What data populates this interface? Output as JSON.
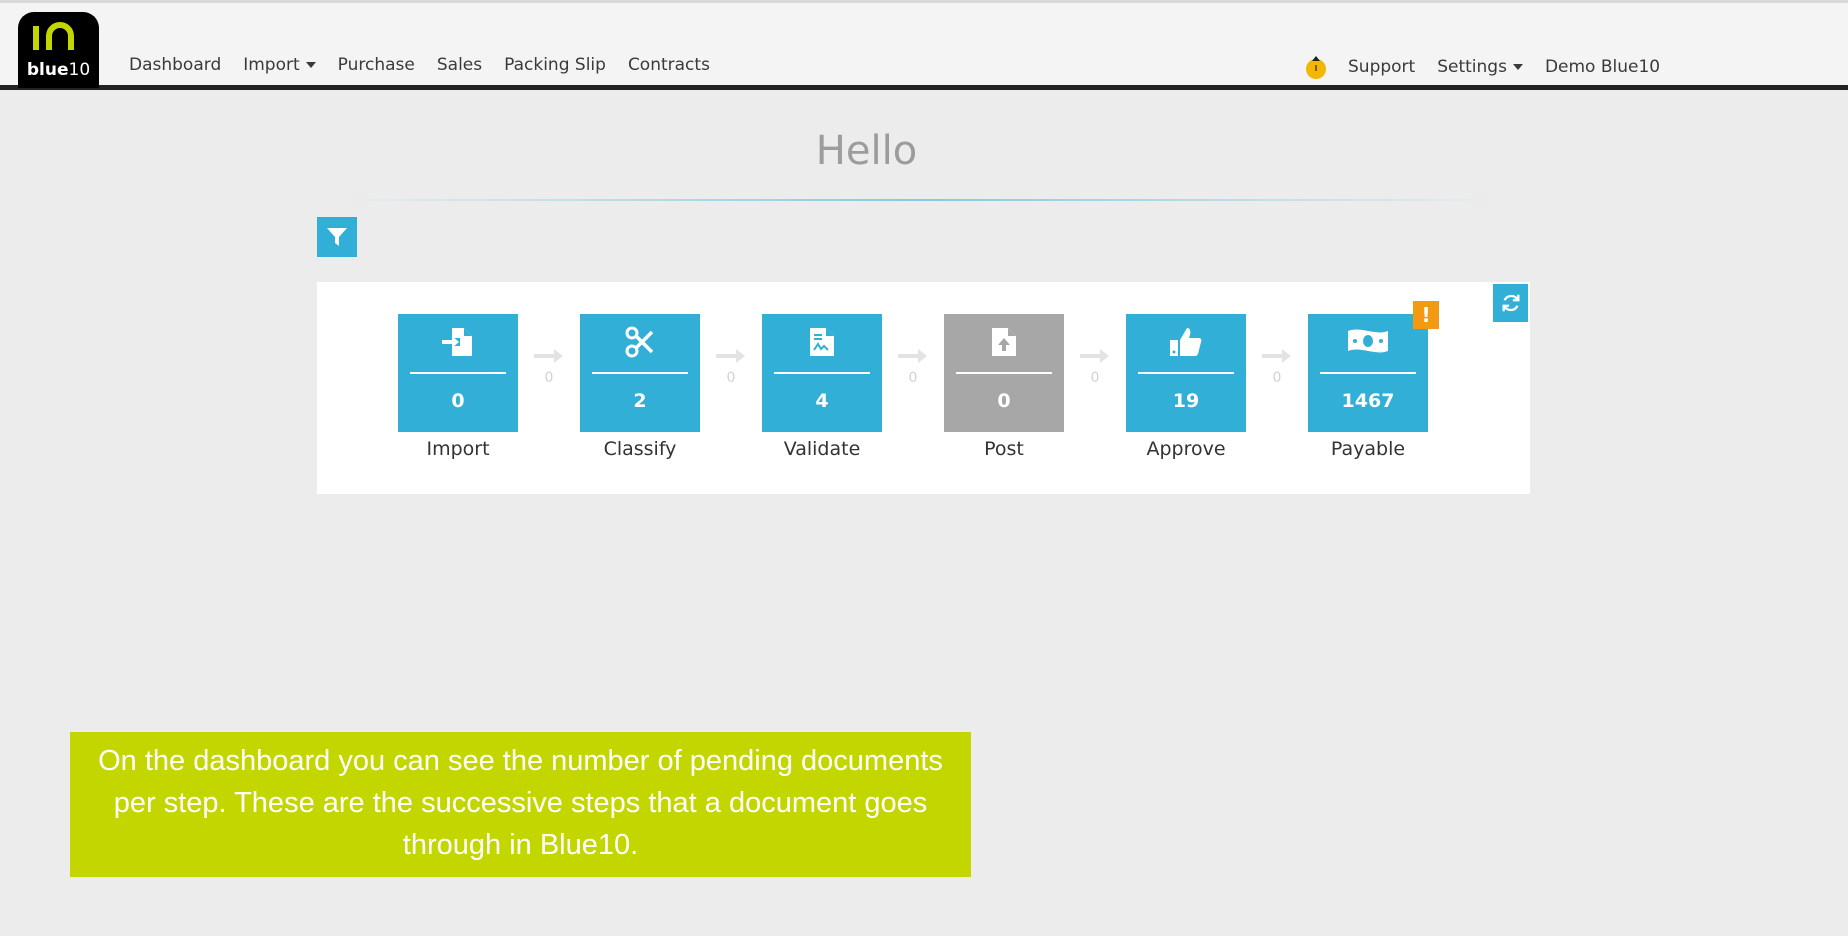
{
  "logo": {
    "glyph": "1∩",
    "text_bold": "blue",
    "text_thin": "10"
  },
  "nav": {
    "left": [
      "Dashboard",
      "Import",
      "Purchase",
      "Sales",
      "Packing Slip",
      "Contracts"
    ],
    "right": {
      "support": "Support",
      "settings": "Settings",
      "user": "Demo Blue10"
    }
  },
  "heading": "Hello",
  "steps": [
    {
      "label": "Import",
      "count": "0",
      "icon": "file-import-icon"
    },
    {
      "label": "Classify",
      "count": "2",
      "icon": "scissors-icon"
    },
    {
      "label": "Validate",
      "count": "4",
      "icon": "file-signature-icon"
    },
    {
      "label": "Post",
      "count": "0",
      "icon": "file-upload-icon"
    },
    {
      "label": "Approve",
      "count": "19",
      "icon": "thumbs-up-icon"
    },
    {
      "label": "Payable",
      "count": "1467",
      "icon": "money-bill-icon"
    }
  ],
  "connectors": [
    "0",
    "0",
    "0",
    "0",
    "0"
  ],
  "alert": "!",
  "callout": "On the dashboard you can see the number of pending documents per step. These are the successive steps that a document goes through in Blue10.",
  "colors": {
    "accent": "#31afd6",
    "disabled": "#a7a7a7",
    "warning": "#f29a11",
    "callout": "#c4d600"
  }
}
